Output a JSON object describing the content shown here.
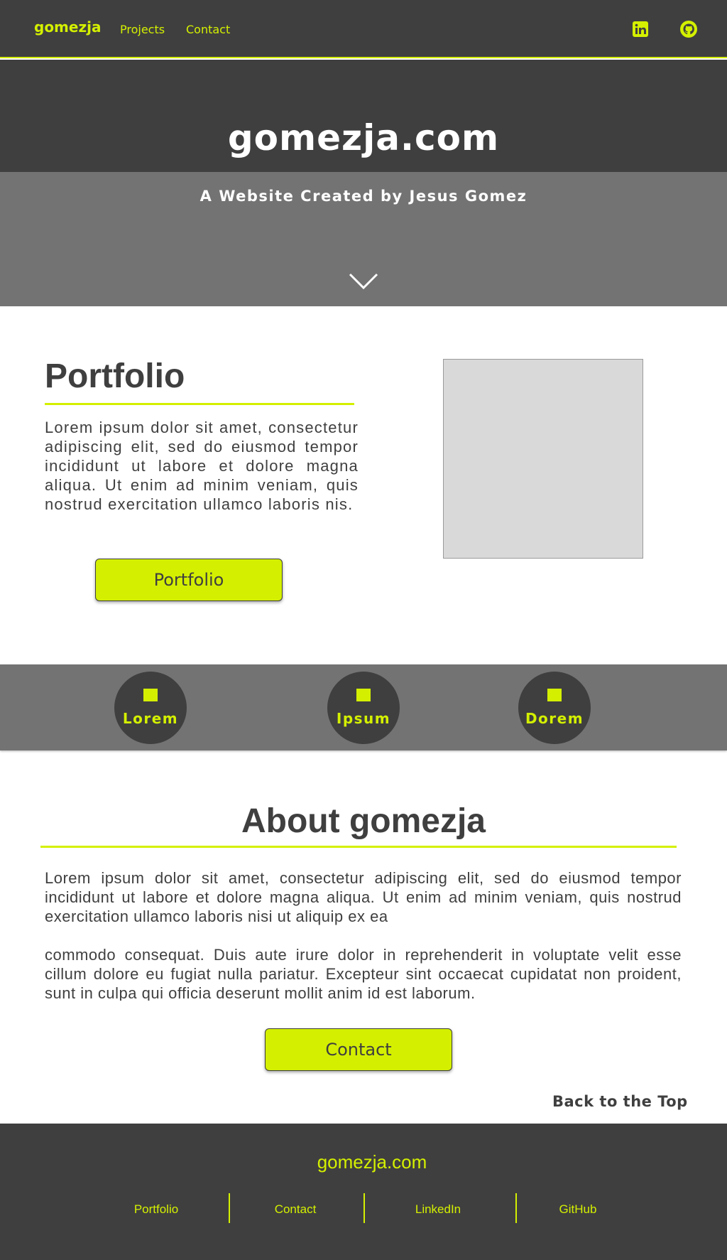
{
  "nav": {
    "logo": "gomezja",
    "links": [
      "Projects",
      "Contact"
    ],
    "icons": [
      "linkedin-icon",
      "github-icon"
    ]
  },
  "hero": {
    "title": "gomezja.com",
    "subtitle": "A Website Created by Jesus Gomez",
    "scroll_icon": "chevron-down-icon"
  },
  "portfolio": {
    "title": "Portfolio",
    "text": "Lorem ipsum dolor sit amet, consectetur adipiscing elit, sed do eiusmod tempor incididunt ut labore et dolore magna aliqua. Ut enim ad minim veniam, quis nostrud exercitation ullamco laboris nis.",
    "button": "Portfolio"
  },
  "features": [
    {
      "label": "Lorem"
    },
    {
      "label": "Ipsum"
    },
    {
      "label": "Dorem"
    }
  ],
  "about": {
    "title": "About gomezja",
    "paragraphs": [
      "Lorem ipsum dolor sit amet, consectetur adipiscing elit, sed do eiusmod tempor incididunt ut labore et dolore magna aliqua. Ut enim ad minim veniam, quis nostrud exercitation ullamco laboris nisi ut aliquip ex ea",
      "commodo consequat. Duis aute irure dolor in reprehenderit in voluptate velit esse cillum dolore eu fugiat nulla pariatur. Excepteur sint occaecat cupidatat non proident, sunt in culpa qui officia deserunt mollit anim id est laborum."
    ],
    "button": "Contact",
    "back_to_top": "Back to the Top"
  },
  "footer": {
    "title": "gomezja.com",
    "links": [
      "Portfolio",
      "Contact",
      "LinkedIn",
      "GitHub"
    ]
  },
  "colors": {
    "accent": "#d4f000",
    "dark": "#3f3f3f",
    "mid": "#737373",
    "placeholder": "#d9d9d9"
  }
}
